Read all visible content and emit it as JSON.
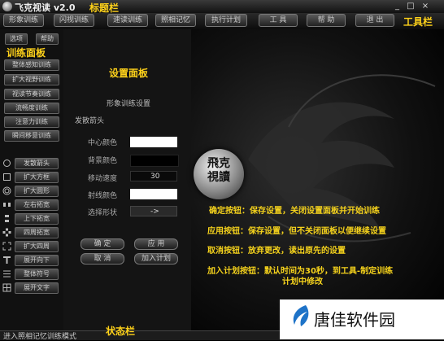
{
  "window": {
    "title": "飞克视读 v2.0",
    "title_annotation": "标题栏",
    "controls": "_ □ ×"
  },
  "menu": {
    "items": [
      "形象训练",
      "闪视训练",
      "速读训练",
      "照相记忆",
      "执行计划",
      "工  具",
      "帮  助",
      "退  出"
    ],
    "annotation": "工具栏"
  },
  "left_panel": {
    "top_buttons": [
      "选项",
      "帮助"
    ],
    "annotation": "训练面板",
    "training_buttons": [
      "整体感知训练",
      "扩大视野训练",
      "视读节奏训练",
      "流畅度训练",
      "注意力训练",
      "瞬间移意训练"
    ],
    "shape_buttons": [
      {
        "label": "发散箭头",
        "icon": "circle-outline-icon"
      },
      {
        "label": "扩大方框",
        "icon": "square-outline-icon"
      },
      {
        "label": "扩大圆形",
        "icon": "concentric-circles-icon"
      },
      {
        "label": "左右拓宽",
        "icon": "horizontal-bars-icon"
      },
      {
        "label": "上下拓宽",
        "icon": "vertical-bars-icon"
      },
      {
        "label": "四周拓宽",
        "icon": "four-way-icon"
      },
      {
        "label": "扩大四周",
        "icon": "expand-corners-icon"
      },
      {
        "label": "展开向下",
        "icon": "down-t-icon"
      },
      {
        "label": "整体符号",
        "icon": "symbols-icon"
      },
      {
        "label": "展开文字",
        "icon": "text-grid-icon"
      }
    ]
  },
  "settings": {
    "annotation": "设置面板",
    "section": "形象训练设置",
    "subtitle": "发散箭头",
    "fields": [
      {
        "label": "中心颜色",
        "value": "",
        "color": "#ffffff"
      },
      {
        "label": "背景颜色",
        "value": "",
        "color": "#000000"
      },
      {
        "label": "移动速度",
        "value": "30",
        "color": "#0a0a0a"
      },
      {
        "label": "射线颜色",
        "value": "",
        "color": "#ffffff"
      },
      {
        "label": "选择形状",
        "value": "->",
        "color": "#2a2a2a"
      }
    ],
    "buttons": {
      "ok": "确  定",
      "apply": "应  用",
      "cancel": "取  消",
      "add_plan": "加入计划"
    }
  },
  "main": {
    "logo_text": "飛克\n視讀",
    "help_lines": [
      "确定按钮：保存设置，关闭设置面板并开始训练",
      "应用按钮：保存设置，但不关闭面板以便继续设置",
      "取消按钮：放弃更改，读出原先的设置",
      "加入计划按钮：默认时间为30秒，到工具-制定训练",
      "计划中修改"
    ]
  },
  "status": {
    "text": "进入照相记忆训练模式",
    "annotation": "状态栏"
  },
  "watermark": {
    "text": "唐佳软件园"
  },
  "colors": {
    "annotation": "#ffd21a",
    "help": "#f5d21c",
    "watermark_blue": "#1e73c8"
  }
}
